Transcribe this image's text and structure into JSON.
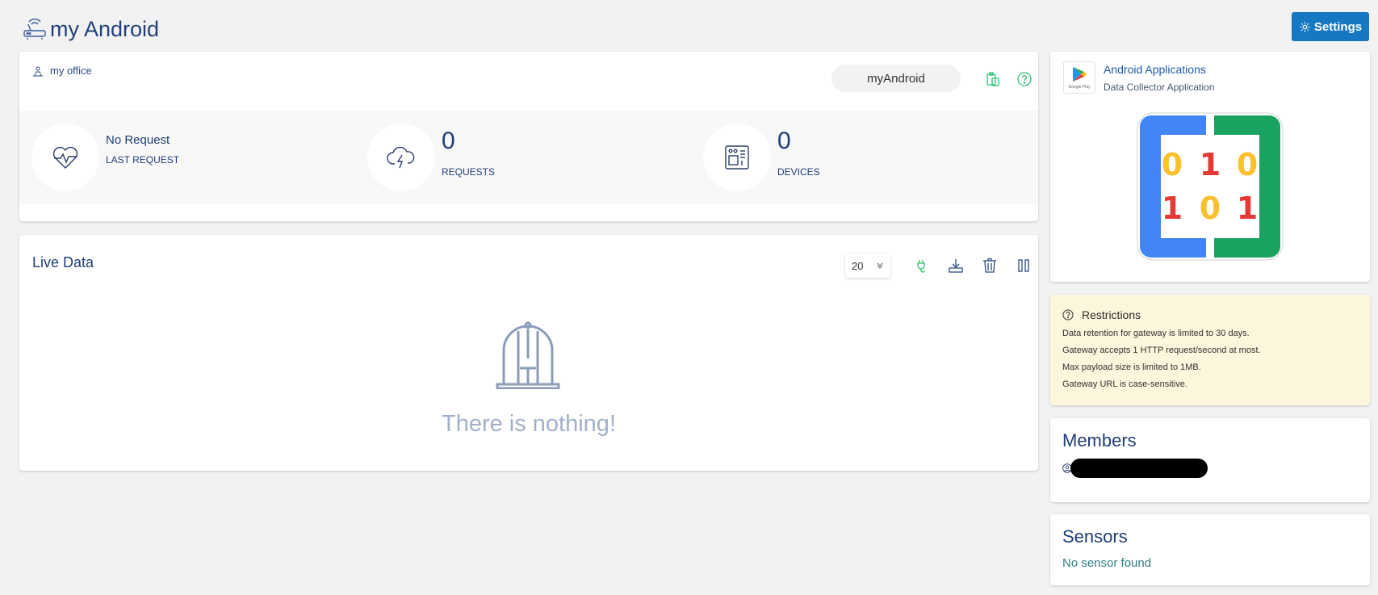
{
  "header": {
    "title": "my Android",
    "settings_label": "Settings"
  },
  "gateway": {
    "location": "my office",
    "name": "myAndroid",
    "stats": {
      "last_request_value": "No Request",
      "last_request_label": "LAST REQUEST",
      "requests_value": "0",
      "requests_label": "REQUESTS",
      "devices_value": "0",
      "devices_label": "DEVICES"
    }
  },
  "live_data": {
    "title": "Live Data",
    "page_size": "20",
    "empty_text": "There is nothing!"
  },
  "app": {
    "name": "Android Applications",
    "description": "Data Collector Application",
    "store_caption": "Google Play",
    "logo_digits": [
      "0",
      "1",
      "0",
      "1",
      "0",
      "1"
    ]
  },
  "restrictions": {
    "title": "Restrictions",
    "items": [
      "Data retention for gateway is limited to 30 days.",
      "Gateway accepts 1 HTTP request/second at most.",
      "Max payload size is limited to 1MB.",
      "Gateway URL is case-sensitive."
    ]
  },
  "members": {
    "title": "Members"
  },
  "sensors": {
    "title": "Sensors",
    "empty_text": "No sensor found"
  },
  "colors": {
    "accent": "#1677c3",
    "title_blue": "#1f3d78",
    "green_icon": "#2fbf71",
    "restriction_bg": "#fbf6dc",
    "logo_blue": "#4285f4",
    "logo_green": "#1aa260",
    "logo_yellow": "#fbc02d",
    "logo_red": "#e53935"
  },
  "icons": {
    "header": "router-icon",
    "settings": "gear-icon",
    "location": "office-icon",
    "copy": "clipboard-icon",
    "help": "help-icon",
    "last_request": "heartbeat-icon",
    "requests": "cloud-bolt-icon",
    "devices": "chip-icon",
    "plug": "plug-icon",
    "download": "download-icon",
    "delete": "trash-icon",
    "pause": "pause-icon",
    "empty": "birdcage-icon"
  }
}
